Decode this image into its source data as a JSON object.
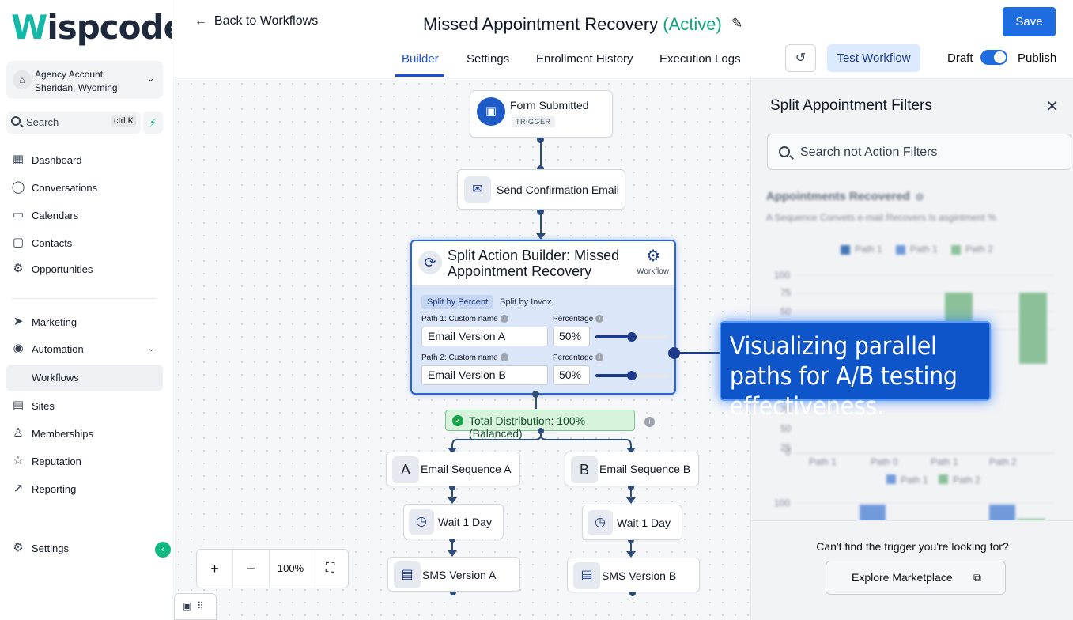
{
  "brand": {
    "logo_w": "W",
    "logo_rest": "ispcode"
  },
  "account": {
    "title": "Agency Account",
    "subtitle": "Sheridan, Wyoming"
  },
  "search": {
    "label": "Search",
    "shortcut": "ctrl K"
  },
  "sidebar": {
    "items": [
      {
        "label": "Dashboard",
        "icon": "grid-icon"
      },
      {
        "label": "Conversations",
        "icon": "chat-icon"
      },
      {
        "label": "Calendars",
        "icon": "calendar-icon"
      },
      {
        "label": "Contacts",
        "icon": "contacts-icon"
      },
      {
        "label": "Opportunities",
        "icon": "funnel-icon"
      },
      {
        "label": "Marketing",
        "icon": "send-icon"
      },
      {
        "label": "Automation",
        "icon": "automation-icon"
      },
      {
        "label": "Workflows",
        "icon": ""
      },
      {
        "label": "Sites",
        "icon": "sites-icon"
      },
      {
        "label": "Memberships",
        "icon": "membership-icon"
      },
      {
        "label": "Reputation",
        "icon": "star-icon"
      },
      {
        "label": "Reporting",
        "icon": "trend-icon"
      },
      {
        "label": "Settings",
        "icon": "gear-icon"
      }
    ]
  },
  "header": {
    "back_label": "Back to Workflows",
    "workflow_title": "Missed Appointment Recovery",
    "workflow_status": "(Active)",
    "save_label": "Save",
    "tabs": [
      "Builder",
      "Settings",
      "Enrollment History",
      "Execution Logs"
    ],
    "test_label": "Test Workflow",
    "draft_label": "Draft",
    "publish_label": "Publish",
    "published": true
  },
  "canvas": {
    "trigger": {
      "label": "Form Submitted",
      "badge": "TRIGGER"
    },
    "confirm_email": {
      "label": "Send Confirmation Email"
    },
    "split": {
      "title": "Split Action Builder: Missed Appointment Recovery",
      "workflow_label": "Workflow",
      "tab_percent": "Split by Percent",
      "tab_invox": "Split by Invox",
      "path1_label": "Path 1: Custom name",
      "path1_value": "Email Version A",
      "path1_pct_label": "Percentage",
      "path1_pct": "50%",
      "path1_fraction": 0.5,
      "path2_label": "Path 2: Custom name",
      "path2_value": "Email Version B",
      "path2_pct_label": "Percentage",
      "path2_pct": "50%",
      "path2_fraction": 0.5
    },
    "distribution": "Total Distribution: 100% (Balanced)",
    "branch_a": {
      "letter": "A",
      "label": "Email Sequence A",
      "wait": "Wait 1 Day",
      "sms": "SMS Version A"
    },
    "branch_b": {
      "letter": "B",
      "label": "Email Sequence B",
      "wait": "Wait 1 Day",
      "sms": "SMS Version B"
    },
    "zoom_level": "100%"
  },
  "callout": {
    "text": "Visualizing parallel paths for A/B testing effectiveness."
  },
  "panel": {
    "title": "Split Appointment Filters",
    "search_placeholder": "Search not Action Filters",
    "chart_title": "Appointments Recovered",
    "chart_subtitle": "A Sequence Convets e-mail Recovers Is asgintment %",
    "legend": [
      "Path 1",
      "Path 1",
      "Path 2"
    ],
    "legend2": [
      "Path 1",
      "Path 2"
    ],
    "x_labels": [
      "Path 1",
      "Path 0",
      "Path 1",
      "Path 2"
    ],
    "footer_question": "Can't find the trigger you're looking for?",
    "marketplace_label": "Explore Marketplace"
  },
  "colors": {
    "accent": "#1d6ce0",
    "active_status": "#10a37f",
    "node_border": "#2563eb",
    "success": "#16a34a"
  }
}
